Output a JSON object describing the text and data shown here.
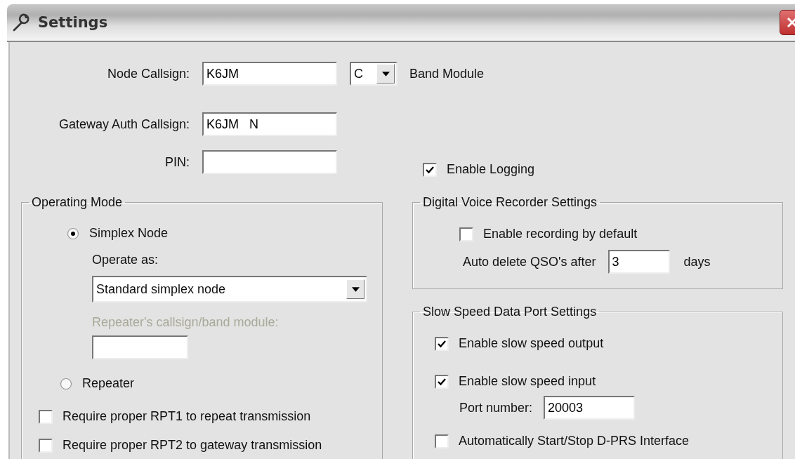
{
  "window": {
    "title": "Settings"
  },
  "node": {
    "callsign_label": "Node Callsign:",
    "callsign": "K6JM",
    "band_module": "C",
    "band_module_label": "Band Module",
    "gateway_label": "Gateway Auth Callsign:",
    "gateway_callsign": "K6JM   N",
    "pin_label": "PIN:"
  },
  "enable_logging": {
    "label": "Enable Logging",
    "checked": true
  },
  "operating_mode": {
    "title": "Operating Mode",
    "options": [
      {
        "label": "Simplex Node",
        "selected": true
      },
      {
        "label": "Repeater",
        "selected": false
      }
    ],
    "operate_as_label": "Operate as:",
    "operate_as": "Standard simplex node",
    "repeater_label": "Repeater's callsign/band module:",
    "repeater_disabled": true,
    "checkboxes": [
      {
        "label": "Require proper RPT1 to repeat transmission",
        "checked": false
      },
      {
        "label": "Require proper RPT2 to gateway transmission",
        "checked": false
      }
    ]
  },
  "dvr": {
    "title": "Digital Voice Recorder Settings",
    "enable": {
      "label": "Enable recording by default",
      "checked": false
    },
    "delete_label": "Auto delete QSO's after",
    "delete_days": "3",
    "days_label": "days"
  },
  "slow_speed": {
    "title": "Slow Speed Data Port Settings",
    "output": {
      "label": "Enable slow speed output",
      "checked": true
    },
    "input": {
      "label": "Enable slow speed input",
      "checked": true
    },
    "port_label": "Port number:",
    "port": "20003",
    "dprs": {
      "label": "Automatically Start/Stop D-PRS Interface",
      "checked": false
    }
  }
}
